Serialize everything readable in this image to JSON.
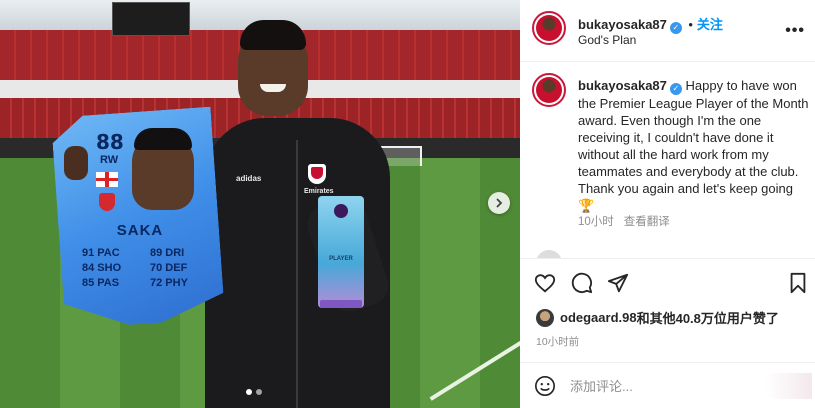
{
  "photo": {
    "card": {
      "rating": "88",
      "position": "RW",
      "name": "SAKA",
      "stats": [
        [
          "91 PAC",
          "89 DRI"
        ],
        [
          "84 SHO",
          "70 DEF"
        ],
        [
          "85 PAS",
          "72 PHY"
        ]
      ]
    },
    "trophy_text": "PLAYER",
    "jacket_brand": "adidas",
    "jacket_sponsor": "Emirates",
    "carousel": {
      "count": 2,
      "active": 0
    }
  },
  "header": {
    "username": "bukayosaka87",
    "follow_label": "关注",
    "subtitle": "God's Plan"
  },
  "caption": {
    "username": "bukayosaka87",
    "text": "Happy to have won the Premier League Player of the Month award. Even though I'm the one receiving it, I couldn't have done it without all the hard work from my teammates and everybody at the club. Thank you again and let's keep going 🏆",
    "time": "10小时",
    "translate_label": "查看翻译"
  },
  "likes": {
    "user": "odegaard.98",
    "text": "和其他40.8万位用户赞了"
  },
  "post_time": "10小时前",
  "comment": {
    "placeholder": "添加评论..."
  },
  "colors": {
    "accent": "#0095f6",
    "verified": "#3897f0",
    "avatar_ring": "#c9183b"
  }
}
